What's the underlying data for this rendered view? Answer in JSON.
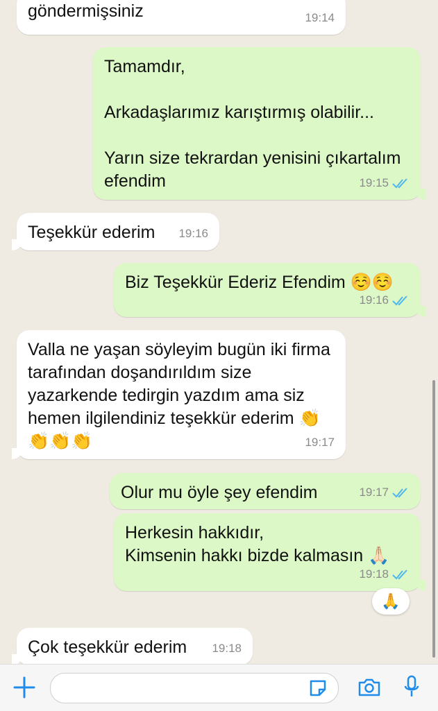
{
  "messages": [
    {
      "id": "m1",
      "direction": "in",
      "text": "göndermişsiniz",
      "time": "19:14",
      "ticks": false
    },
    {
      "id": "m2",
      "direction": "out",
      "text": "Tamamdır,\n\nArkadaşlarımız karıştırmış olabilir...\n\nYarın size tekrardan yenisini çıkartalım efendim",
      "time": "19:15",
      "ticks": true
    },
    {
      "id": "m3",
      "direction": "in",
      "text": "Teşekkür ederim",
      "time": "19:16",
      "ticks": false
    },
    {
      "id": "m4",
      "direction": "out",
      "text": "Biz Teşekkür Ederiz Efendim ☺️☺️",
      "time": "19:16",
      "ticks": true
    },
    {
      "id": "m5",
      "direction": "in",
      "text": "Valla ne yaşan söyleyim bugün iki firma tarafından doşandırıldım size yazarkende tedirgin yazdım ama siz hemen ilgilendiniz teşekkür ederim 👏\n👏👏👏",
      "time": "19:17",
      "ticks": false
    },
    {
      "id": "m6",
      "direction": "out",
      "text": "Olur mu öyle şey efendim",
      "time": "19:17",
      "ticks": true
    },
    {
      "id": "m7",
      "direction": "out",
      "text": "Herkesin hakkıdır,\nKimsenin hakkı bizde kalmasın 🙏🏻",
      "time": "19:18",
      "ticks": true,
      "reaction": "🙏"
    },
    {
      "id": "m8",
      "direction": "in",
      "text": "Çok teşekkür ederim",
      "time": "19:18",
      "ticks": false
    }
  ],
  "composer": {
    "input_value": "",
    "icons": [
      "plus-icon",
      "sticker-icon",
      "camera-icon",
      "microphone-icon"
    ]
  },
  "colors": {
    "incoming_bubble": "#ffffff",
    "outgoing_bubble": "#dcf8c6",
    "tick_blue": "#4fb6ec",
    "accent": "#1f8ceb"
  }
}
